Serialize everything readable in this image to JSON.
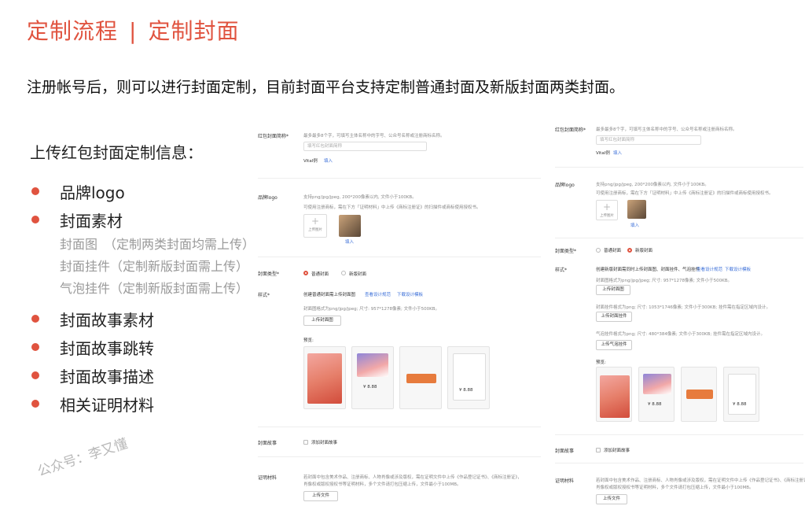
{
  "title": {
    "main": "定制流程",
    "separator": "|",
    "sub": "定制封面"
  },
  "intro": "注册帐号后，则可以进行封面定制，目前封面平台支持定制普通封面及新版封面两类封面。",
  "left": {
    "heading": "上传红包封面定制信息：",
    "items": [
      "品牌logo",
      "封面素材",
      "封面故事素材",
      "封面故事跳转",
      "封面故事描述",
      "相关证明材料"
    ],
    "sub_items": [
      "封面图　（定制两类封面均需上传）",
      "封面挂件（定制新版封面需上传）",
      "气泡挂件（定制新版封面需上传）"
    ]
  },
  "watermark": "公众号：李又懂",
  "panel1": {
    "name_label": "红包封面简称*",
    "name_hint": "最多最多8个字，可填写主体名称中的字号、公众号名称或注册商标名称。",
    "name_placeholder": "填写红包封面简称",
    "vital_text": "Vital例",
    "fill_in": "填入",
    "logo_label": "品牌logo",
    "logo_hint1": "支持png/jpg/jpeg, 200*200像素以内, 文件小于100KB。",
    "logo_hint2": "可使用注册商标，需在下方「证明材料」中上传《商标注册证》的扫描件或商标使用授权书。",
    "upload_label": "上传图片",
    "type_label": "封面类型*",
    "type_normal": "普通封面",
    "type_new": "新版封面",
    "style_label": "样式*",
    "style_create": "创建普通封面需上传封面图",
    "style_view_spec": "查看设计规范",
    "style_download": "下载设计模板",
    "cover_hint": "封面图格式为png/jpg/jpeg; 尺寸: 957*1278像素; 文件小于500KB。",
    "upload_cover": "上传封面图",
    "preview_label": "预览:",
    "amount": "¥ 8.88",
    "story_label": "封面故事",
    "story_add": "添加封面故事",
    "proof_label": "证明材料",
    "proof_hint1": "若封面中包含美术作品、注册商标、人物肖像或涉及版权，需在证明文件中上传《作品登记证书》、《商标注册证》，",
    "proof_hint2": "肖像权或版权授权书等证明材料，多个文件请打包压缩上传，文件最小于100MB。",
    "upload_file": "上传文件"
  },
  "panel2": {
    "name_label": "红包封面简称*",
    "name_hint": "最多最多8个字，可填写主体名称中的字号、公众号名称或注册商标名称。",
    "name_placeholder": "填写红包封面简称",
    "vital_text": "Vital例",
    "fill_in": "填入",
    "logo_label": "品牌logo",
    "logo_hint1": "支持png/jpg/jpeg, 200*200像素以内, 文件小于100KB。",
    "logo_hint2": "可使用注册商标，需在下方「证明材料」中上传《商标注册证》的扫描件或商标使用授权书。",
    "upload_label": "上传图片",
    "type_label": "封面类型*",
    "type_normal": "普通封面",
    "type_new": "新版封面",
    "style_label": "样式*",
    "style_create": "创建新版封面需同时上传封面图、封面挂件、气泡挂件",
    "style_view_spec": "查看设计规范",
    "style_download": "下载设计模板",
    "cover_hint": "封面图格式为png/jpg/jpeg; 尺寸: 957*1278像素; 文件小于500KB。",
    "upload_cover": "上传封面图",
    "pendant_hint": "封面挂件格式为png; 尺寸: 1053*1746像素; 文件小于300KB; 挂件需在指定区域内设计。",
    "upload_pendant": "上传封面挂件",
    "bubble_hint": "气泡挂件格式为png; 尺寸: 480*384像素; 文件小于300KB; 挂件需在指定区域内设计。",
    "upload_bubble": "上传气泡挂件",
    "preview_label": "预览:",
    "amount": "¥ 8.88",
    "story_label": "封面故事",
    "story_add": "添加封面故事",
    "proof_label": "证明材料",
    "proof_hint1": "若封面中包含美术作品、注册商标、人物肖像或涉及版权，需在证明文件中上传《作品登记证书》、《商标注册证》，",
    "proof_hint2": "肖像权或版权授权书等证明材料，多个文件请打包压缩上传，文件最小于100MB。",
    "upload_file": "上传文件"
  },
  "colors": {
    "accent": "#e0533f",
    "link": "#3b6fd8"
  }
}
